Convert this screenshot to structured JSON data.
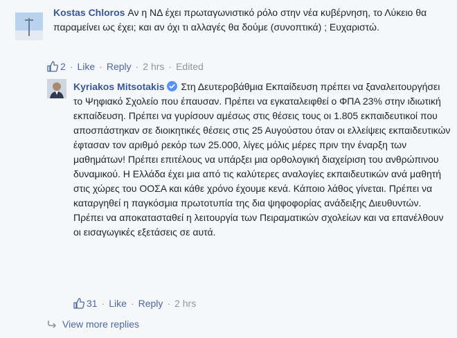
{
  "comments": [
    {
      "author": "Kostas Chloros",
      "text": "Αν η ΝΔ έχει πρωταγωνιστικό ρόλο στην νέα κυβέρνηση, το Λύκειο θα παραμείνει ως έχει; και αν όχι τι αλλαγές θα δούμε (συνοπτικά) ; Ευχαριστώ.",
      "likes": "2",
      "like_label": "Like",
      "reply_label": "Reply",
      "time": "2 hrs",
      "edited": "Edited"
    },
    {
      "author": "Kyriakos Mitsotakis",
      "verified": true,
      "text": "Στη Δευτεροβάθμια Εκπαίδευση πρέπει να ξαναλειτουργήσει το Ψηφιακό Σχολείο που έπαυσαν. Πρέπει να εγκαταλειφθεί ο ΦΠΑ 23% στην ιδιωτική εκπαίδευση. Πρέπει να γυρίσουν αμέσως στις θέσεις τους οι 1.805 εκπαιδευτικοί που αποσπάστηκαν σε διοικητικές θέσεις στις 25 Αυγούστου όταν οι ελλείψεις εκπαιδευτικών έφτασαν τον αριθμό ρεκόρ των 25.000, λίγες μόλις μέρες πριν την έναρξη των μαθημάτων! Πρέπει επιτέλους να υπάρξει μια ορθολογική διαχείριση του ανθρώπινου δυναμικού. Η Ελλάδα έχει μια από τις καλύτερες αναλογίες εκπαιδευτικών ανά μαθητή στις χώρες του ΟΟΣΑ και κάθε χρόνο έχουμε κενά. Κάποιο λάθος γίνεται. Πρέπει να καταργηθεί η παγκόσμια πρωτοτυπία της δια ψηφοφορίας ανάδειξης Διευθυντών. Πρέπει να αποκατασταθεί η λειτουργία των Πειραματικών σχολείων και να επανέλθουν οι εισαγωγικές εξετάσεις σε αυτά.",
      "likes": "31",
      "like_label": "Like",
      "reply_label": "Reply",
      "time": "2 hrs"
    }
  ],
  "view_more": "View more replies",
  "icons": {
    "like": "thumbs-up-icon",
    "verified": "verified-badge-icon",
    "more": "reply-arrow-icon"
  },
  "colors": {
    "link": "#365899",
    "action": "#4b67a1",
    "meta": "#90949c",
    "verified": "#5890ff"
  }
}
